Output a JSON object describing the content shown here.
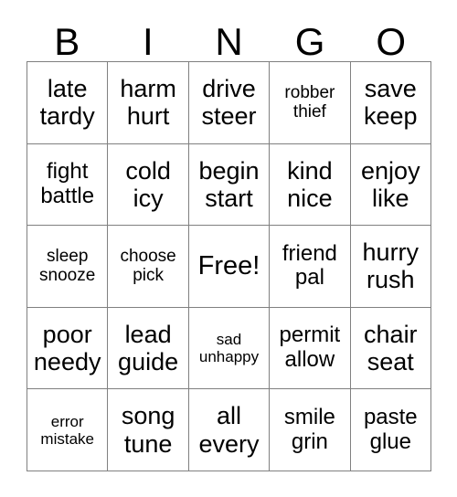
{
  "card": {
    "header_letters": [
      "B",
      "I",
      "N",
      "G",
      "O"
    ],
    "free_space_label": "Free!",
    "border_color": "#808080",
    "text_color": "#000000",
    "background_color": "#ffffff",
    "rows": [
      [
        {
          "top": "late",
          "bottom": "tardy",
          "size": "lg"
        },
        {
          "top": "harm",
          "bottom": "hurt",
          "size": "lg"
        },
        {
          "top": "drive",
          "bottom": "steer",
          "size": "lg"
        },
        {
          "top": "robber",
          "bottom": "thief",
          "size": "sm"
        },
        {
          "top": "save",
          "bottom": "keep",
          "size": "lg"
        }
      ],
      [
        {
          "top": "fight",
          "bottom": "battle",
          "size": "md"
        },
        {
          "top": "cold",
          "bottom": "icy",
          "size": "lg"
        },
        {
          "top": "begin",
          "bottom": "start",
          "size": "lg"
        },
        {
          "top": "kind",
          "bottom": "nice",
          "size": "lg"
        },
        {
          "top": "enjoy",
          "bottom": "like",
          "size": "lg"
        }
      ],
      [
        {
          "top": "sleep",
          "bottom": "snooze",
          "size": "sm"
        },
        {
          "top": "choose",
          "bottom": "pick",
          "size": "sm"
        },
        {
          "top": "Free!",
          "bottom": "",
          "size": "free"
        },
        {
          "top": "friend",
          "bottom": "pal",
          "size": "md"
        },
        {
          "top": "hurry",
          "bottom": "rush",
          "size": "lg"
        }
      ],
      [
        {
          "top": "poor",
          "bottom": "needy",
          "size": "lg"
        },
        {
          "top": "lead",
          "bottom": "guide",
          "size": "lg"
        },
        {
          "top": "sad",
          "bottom": "unhappy",
          "size": "xs"
        },
        {
          "top": "permit",
          "bottom": "allow",
          "size": "md"
        },
        {
          "top": "chair",
          "bottom": "seat",
          "size": "lg"
        }
      ],
      [
        {
          "top": "error",
          "bottom": "mistake",
          "size": "xs"
        },
        {
          "top": "song",
          "bottom": "tune",
          "size": "lg"
        },
        {
          "top": "all",
          "bottom": "every",
          "size": "lg"
        },
        {
          "top": "smile",
          "bottom": "grin",
          "size": "md"
        },
        {
          "top": "paste",
          "bottom": "glue",
          "size": "md"
        }
      ]
    ]
  }
}
